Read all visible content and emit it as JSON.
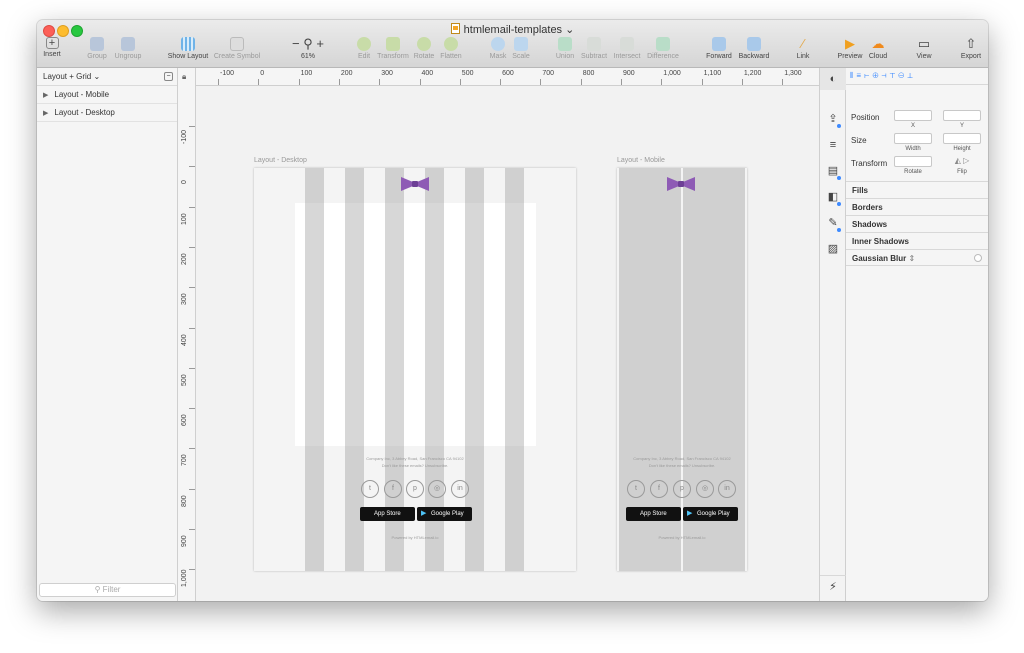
{
  "window": {
    "title": "htmlemail-templates"
  },
  "toolbar": {
    "insert": "Insert",
    "group": "Group",
    "ungroup": "Ungroup",
    "show_layout": "Show Layout",
    "create_symbol": "Create Symbol",
    "zoom_minus": "−",
    "zoom_plus": "+",
    "zoom_value": "61%",
    "edit": "Edit",
    "transform": "Transform",
    "rotate": "Rotate",
    "flatten": "Flatten",
    "mask": "Mask",
    "scale": "Scale",
    "union": "Union",
    "subtract": "Subtract",
    "intersect": "Intersect",
    "difference": "Difference",
    "forward": "Forward",
    "backward": "Backward",
    "link": "Link",
    "preview": "Preview",
    "cloud": "Cloud",
    "view": "View",
    "export": "Export"
  },
  "layers": {
    "page_selector": "Layout + Grid",
    "items": [
      "Layout - Mobile",
      "Layout - Desktop"
    ],
    "filter_placeholder": "Filter"
  },
  "ruler": {
    "horizontal": [
      "-100",
      "0",
      "100",
      "200",
      "300",
      "400",
      "500",
      "600",
      "700",
      "800",
      "900",
      "1,000",
      "1,100",
      "1,200",
      "1,300"
    ],
    "vertical": [
      "-100",
      "0",
      "100",
      "200",
      "300",
      "400",
      "500",
      "600",
      "700",
      "800",
      "900",
      "1,000"
    ]
  },
  "artboards": {
    "desktop": {
      "label": "Layout - Desktop",
      "footer_line1": "Company Inc, 3 Abbey Road, San Francisco CA 94102",
      "footer_line2": "Don't like these emails? Unsubscribe.",
      "social": [
        "t",
        "f",
        "p",
        "◎",
        "in"
      ],
      "appstore_label": "App Store",
      "googleplay_label": "Google Play",
      "powered": "Powered by HTMLemail.io"
    },
    "mobile": {
      "label": "Layout - Mobile",
      "footer_line1": "Company Inc, 3 Abbey Road, San Francisco CA 94102",
      "footer_line2": "Don't like these emails? Unsubscribe.",
      "social": [
        "t",
        "f",
        "p",
        "◎",
        "in"
      ],
      "appstore_label": "App Store",
      "googleplay_label": "Google Play",
      "powered": "Powered by HTMLemail.io"
    }
  },
  "inspector": {
    "position": "Position",
    "x": "X",
    "y": "Y",
    "size": "Size",
    "width": "Width",
    "height": "Height",
    "transform": "Transform",
    "rotate": "Rotate",
    "flip": "Flip",
    "sections": [
      "Fills",
      "Borders",
      "Shadows",
      "Inner Shadows",
      "Gaussian Blur"
    ]
  },
  "colors": {
    "bow": "#8e5bb5",
    "accent": "#3d8aff"
  }
}
